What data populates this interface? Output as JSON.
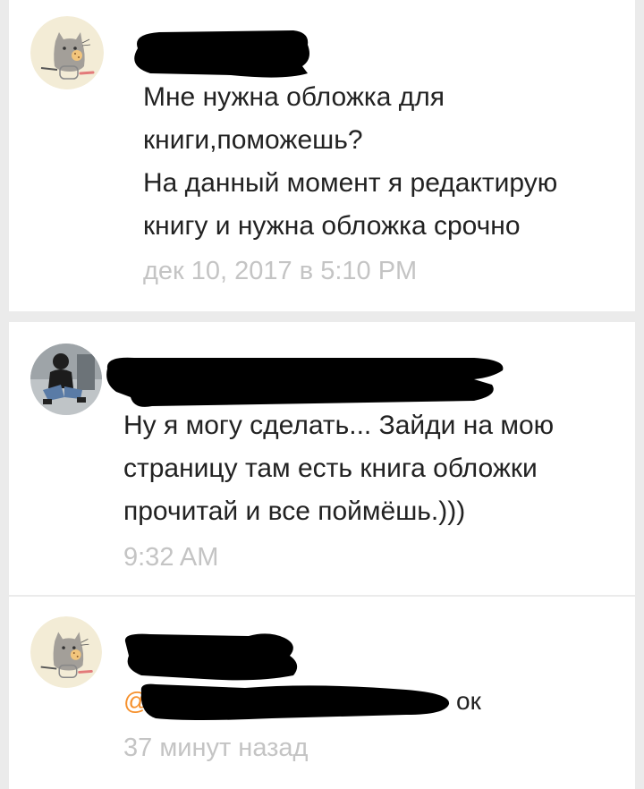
{
  "comments": [
    {
      "author_avatar": "cat-avatar",
      "text_lines": [
        "Мне нужна обложка для",
        "книги,поможешь?",
        "На данный момент я редактирую",
        "книгу и нужна обложка срочно"
      ],
      "timestamp": "дек 10, 2017 в 5:10 PM"
    },
    {
      "author_avatar": "photo-avatar",
      "text_lines": [
        "Ну я могу сделать... Зайди на мою",
        "страницу там есть книга обложки",
        "прочитай и все поймёшь.)))"
      ],
      "timestamp": "9:32 AM"
    },
    {
      "author_avatar": "cat-avatar",
      "mention_prefix": "@",
      "text_suffix": "ок",
      "timestamp": "37 минут назад"
    }
  ],
  "colors": {
    "background": "#ebebeb",
    "card": "#ffffff",
    "text": "#222222",
    "timestamp": "#c4c4c4",
    "mention": "#f6912d",
    "redaction": "#000000"
  }
}
